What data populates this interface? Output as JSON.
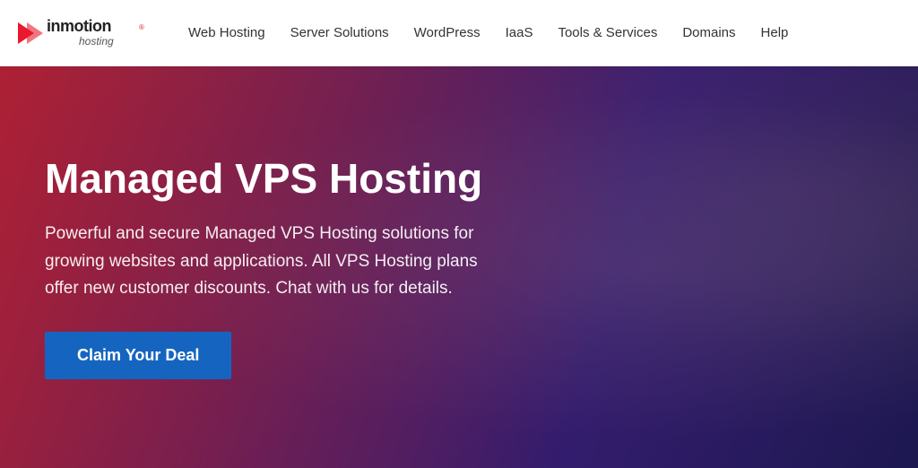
{
  "navbar": {
    "logo_text": "inmotion hosting",
    "nav_items": [
      {
        "label": "Web Hosting",
        "id": "web-hosting"
      },
      {
        "label": "Server Solutions",
        "id": "server-solutions"
      },
      {
        "label": "WordPress",
        "id": "wordpress"
      },
      {
        "label": "IaaS",
        "id": "iaas"
      },
      {
        "label": "Tools & Services",
        "id": "tools-services"
      },
      {
        "label": "Domains",
        "id": "domains"
      },
      {
        "label": "Help",
        "id": "help"
      }
    ]
  },
  "hero": {
    "title": "Managed VPS Hosting",
    "subtitle": "Powerful and secure Managed VPS Hosting solutions for growing websites and applications. All VPS Hosting plans offer new customer discounts. Chat with us for details.",
    "cta_label": "Claim Your Deal"
  }
}
